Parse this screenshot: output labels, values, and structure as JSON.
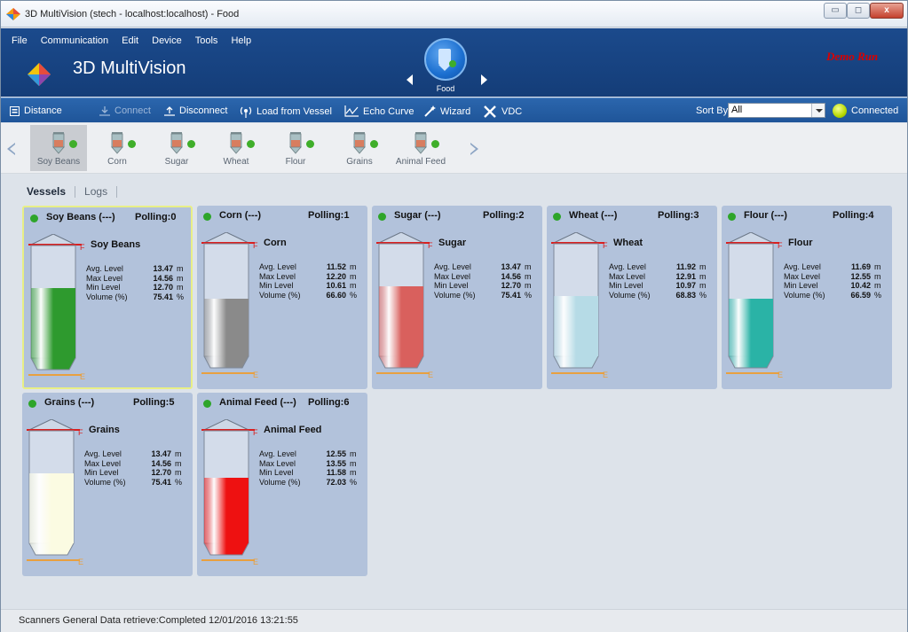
{
  "window": {
    "title": "3D MultiVision (stech - localhost:localhost) - Food",
    "minimize": "▭",
    "maximize": "◻",
    "close": "x"
  },
  "menu": [
    "File",
    "Communication",
    "Edit",
    "Device",
    "Tools",
    "Help"
  ],
  "app": {
    "title": "3D MultiVision",
    "site_label": "Food",
    "demo_label": "Demo Run"
  },
  "toolbar": {
    "distance": "Distance",
    "connect": "Connect",
    "disconnect": "Disconnect",
    "load_from_vessel": "Load from Vessel",
    "echo_curve": "Echo Curve",
    "wizard": "Wizard",
    "vdc": "VDC",
    "sort_by_label": "Sort By:",
    "sort_by_value": "All",
    "connection_status": "Connected"
  },
  "vessel_strip": [
    "Soy Beans",
    "Corn",
    "Sugar",
    "Wheat",
    "Flour",
    "Grains",
    "Animal Feed"
  ],
  "tabs": {
    "vessels": "Vessels",
    "logs": "Logs"
  },
  "labels": {
    "avg": "Avg. Level",
    "max": "Max Level",
    "min": "Min Level",
    "volume": "Volume (%)",
    "full": "F",
    "empty": "E"
  },
  "vessels": [
    {
      "header": "Soy Beans (---)",
      "polling": "Polling:0",
      "name": "Soy Beans",
      "avg": "13.47",
      "max": "14.56",
      "min": "12.70",
      "volume": "75.41",
      "avg_unit": "m",
      "max_unit": "m",
      "min_unit": "m",
      "vol_unit": "%",
      "fill_color": "#2e9a2e",
      "fill_fraction": 0.62
    },
    {
      "header": "Corn (---)",
      "polling": "Polling:1",
      "name": "Corn",
      "avg": "11.52",
      "max": "12.20",
      "min": "10.61",
      "volume": "66.60",
      "avg_unit": "m",
      "max_unit": "m",
      "min_unit": "m",
      "vol_unit": "%",
      "fill_color": "#8a8a8a",
      "fill_fraction": 0.51
    },
    {
      "header": "Sugar (---)",
      "polling": "Polling:2",
      "name": "Sugar",
      "avg": "13.47",
      "max": "14.56",
      "min": "12.70",
      "volume": "75.41",
      "avg_unit": "m",
      "max_unit": "m",
      "min_unit": "m",
      "vol_unit": "%",
      "fill_color": "#d9605d",
      "fill_fraction": 0.62
    },
    {
      "header": "Wheat (---)",
      "polling": "Polling:3",
      "name": "Wheat",
      "avg": "11.92",
      "max": "12.91",
      "min": "10.97",
      "volume": "68.83",
      "avg_unit": "m",
      "max_unit": "m",
      "min_unit": "m",
      "vol_unit": "%",
      "fill_color": "#b6dbe6",
      "fill_fraction": 0.53
    },
    {
      "header": "Flour (---)",
      "polling": "Polling:4",
      "name": "Flour",
      "avg": "11.69",
      "max": "12.55",
      "min": "10.42",
      "volume": "66.59",
      "avg_unit": "m",
      "max_unit": "m",
      "min_unit": "m",
      "vol_unit": "%",
      "fill_color": "#2ab3a6",
      "fill_fraction": 0.51
    },
    {
      "header": "Grains (---)",
      "polling": "Polling:5",
      "name": "Grains",
      "avg": "13.47",
      "max": "14.56",
      "min": "12.70",
      "volume": "75.41",
      "avg_unit": "m",
      "max_unit": "m",
      "min_unit": "m",
      "vol_unit": "%",
      "fill_color": "#fbfbe2",
      "fill_fraction": 0.62
    },
    {
      "header": "Animal Feed (---)",
      "polling": "Polling:6",
      "name": "Animal Feed",
      "avg": "12.55",
      "max": "13.55",
      "min": "11.58",
      "volume": "72.03",
      "avg_unit": "m",
      "max_unit": "m",
      "min_unit": "m",
      "vol_unit": "%",
      "fill_color": "#ee1111",
      "fill_fraction": 0.58
    }
  ],
  "status_bar": "Scanners General Data retrieve:Completed 12/01/2016 13:21:55"
}
